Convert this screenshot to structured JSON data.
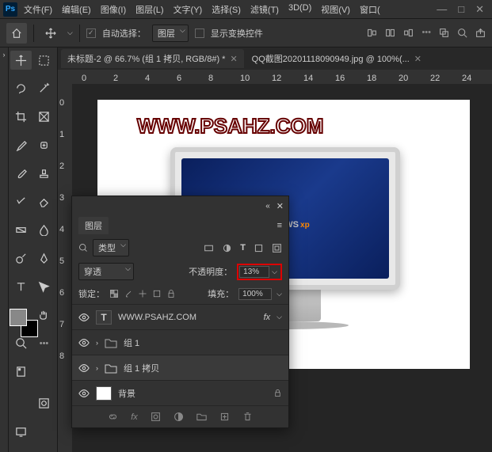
{
  "app": {
    "logo": "Ps"
  },
  "menu": [
    "文件(F)",
    "编辑(E)",
    "图像(I)",
    "图层(L)",
    "文字(Y)",
    "选择(S)",
    "滤镜(T)",
    "3D(D)",
    "视图(V)",
    "窗口("
  ],
  "options": {
    "auto_select_label": "自动选择：",
    "auto_select_target": "图层",
    "show_transform_label": "显示变换控件"
  },
  "tabs": [
    {
      "title": "未标题-2 @ 66.7% (组 1 拷贝, RGB/8#) *"
    },
    {
      "title": "QQ截图20201118090949.jpg @ 100%(..."
    }
  ],
  "ruler_h": [
    "0",
    "2",
    "4",
    "6",
    "8",
    "10",
    "12",
    "14",
    "16",
    "18",
    "20",
    "22",
    "24"
  ],
  "ruler_v": [
    "0",
    "1",
    "2",
    "3",
    "4",
    "5",
    "6",
    "7",
    "8"
  ],
  "canvas": {
    "watermark": "WWW.PSAHZ.COM",
    "xp_text": "WS",
    "xp_suffix": "xp"
  },
  "layers_panel": {
    "tab": "图层",
    "filter_label": "类型",
    "blend_mode": "穿透",
    "opacity_label": "不透明度：",
    "opacity_value": "13%",
    "lock_label": "锁定：",
    "fill_label": "填充：",
    "fill_value": "100%",
    "items": [
      {
        "type": "T",
        "name": "WWW.PSAHZ.COM",
        "fx": "fx"
      },
      {
        "type": "folder",
        "name": "组 1"
      },
      {
        "type": "folder",
        "name": "组 1 拷贝",
        "selected": true
      },
      {
        "type": "bg",
        "name": "背景",
        "locked": true
      }
    ]
  }
}
